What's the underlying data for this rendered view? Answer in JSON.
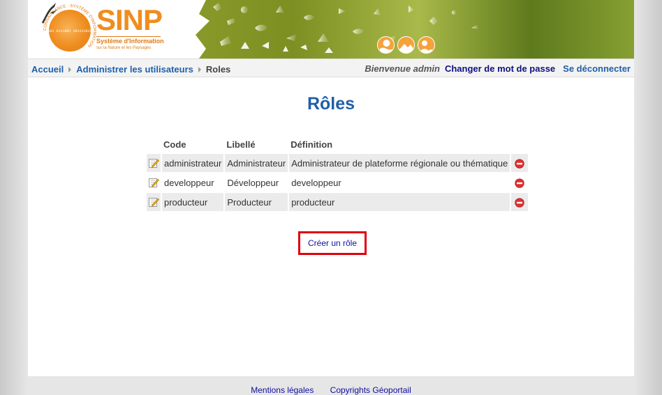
{
  "header": {
    "logo": {
      "name": "SINP",
      "subtitle": "Système d'Information",
      "tagline": "sur la Nature et les Paysages",
      "ring_text": "CONNAISSANCE · SYSTÈME D'INFORMATION",
      "binary": "0101 0111001 1011110100"
    },
    "theme_icons": [
      "water-theme-icon",
      "landscape-theme-icon",
      "nature-theme-icon"
    ],
    "colors": {
      "brand_orange": "#ef8d1e",
      "banner_green": "#7d8f22"
    }
  },
  "breadcrumb": {
    "items": [
      "Accueil",
      "Administrer les utilisateurs"
    ],
    "current": "Roles"
  },
  "account": {
    "welcome": "Bienvenue admin",
    "change_password": "Changer de mot de passe",
    "logout": "Se déconnecter"
  },
  "page_title": "Rôles",
  "table": {
    "headers": [
      "Code",
      "Libellé",
      "Définition"
    ],
    "rows": [
      {
        "code": "administrateur",
        "libelle": "Administrateur",
        "definition": "Administrateur de plateforme régionale ou thématique"
      },
      {
        "code": "developpeur",
        "libelle": "Développeur",
        "definition": "developpeur"
      },
      {
        "code": "producteur",
        "libelle": "Producteur",
        "definition": "producteur"
      }
    ]
  },
  "create_button": "Créer un rôle",
  "footer": {
    "legal": "Mentions légales",
    "copyright": "Copyrights Géoportail"
  }
}
